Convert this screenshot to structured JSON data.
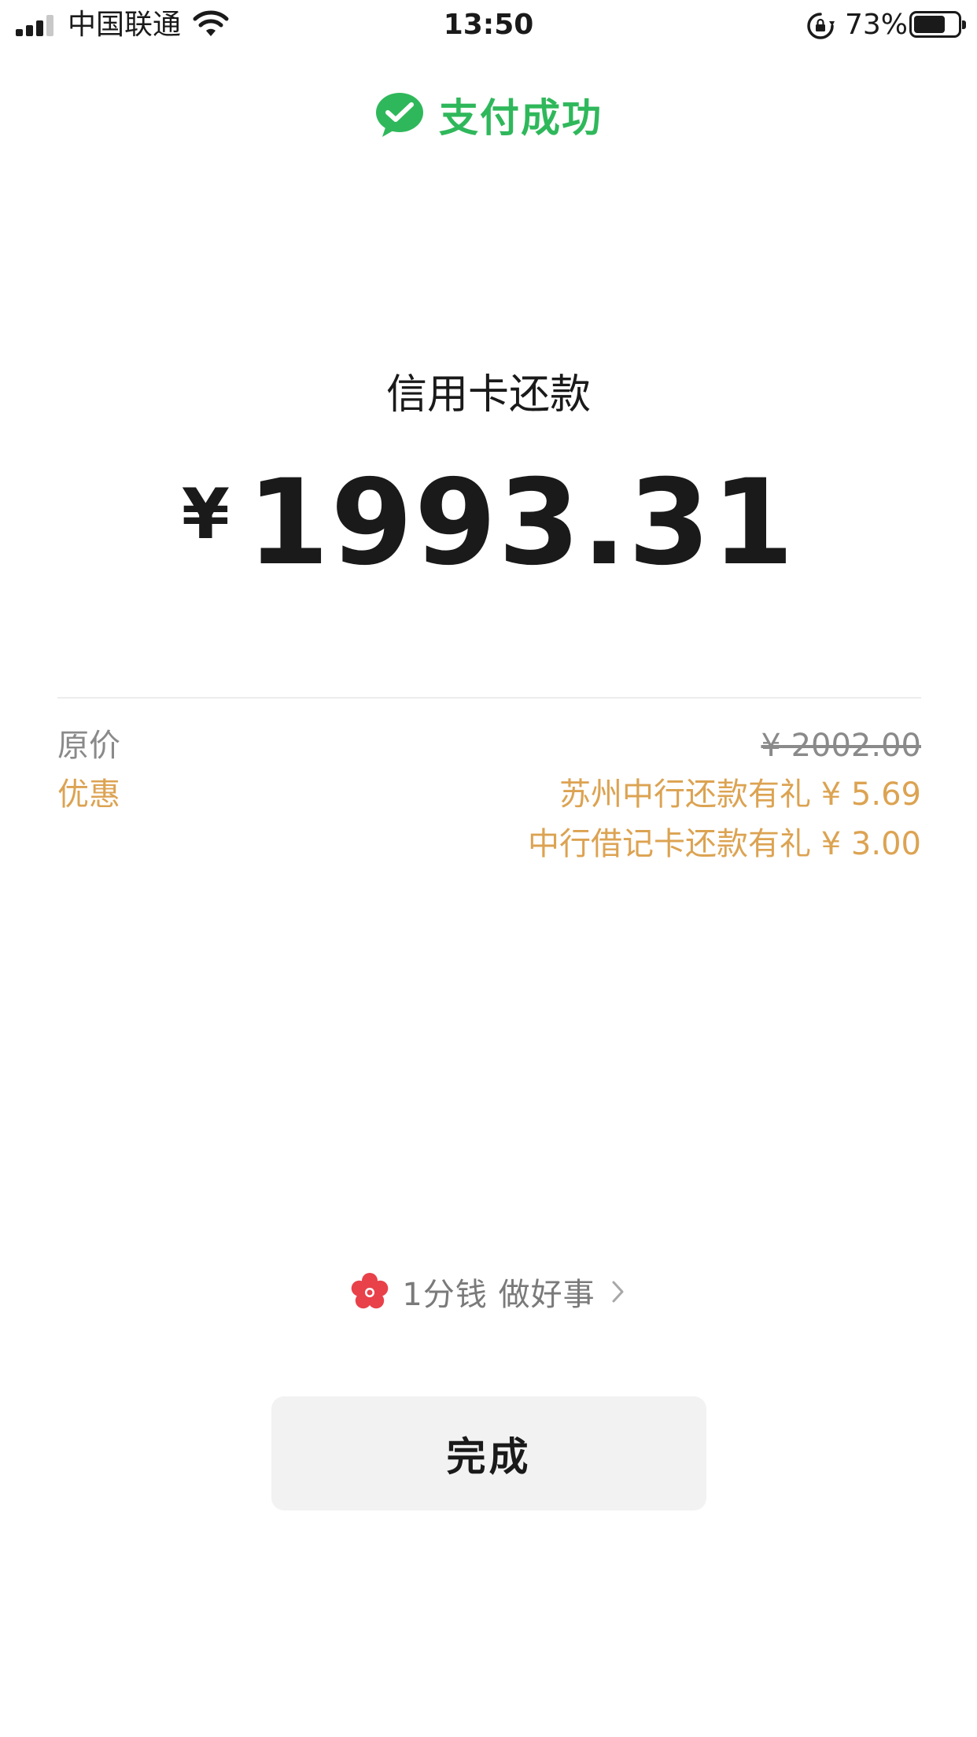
{
  "status_bar": {
    "carrier": "中国联通",
    "time": "13:50",
    "battery_percent": "73%",
    "battery_level": 0.73,
    "icons": [
      "signal-icon",
      "wifi-icon",
      "rotation-lock-icon",
      "battery-icon"
    ]
  },
  "header": {
    "title": "支付成功",
    "icon": "wechat-pay-icon",
    "accent_color": "#2fb85b"
  },
  "payment": {
    "merchant": "信用卡还款",
    "currency_symbol": "¥",
    "amount": "1993.31"
  },
  "details": {
    "original_label": "原价",
    "original_value": "¥ 2002.00",
    "discount_label": "优惠",
    "discounts": [
      "苏州中行还款有礼 ¥ 5.69",
      "中行借记卡还款有礼 ¥ 3.00"
    ],
    "discount_color": "#dca352"
  },
  "charity": {
    "icon": "flower-icon",
    "label": "1分钱 做好事",
    "chevron": "chevron-right-icon"
  },
  "actions": {
    "done_label": "完成"
  }
}
